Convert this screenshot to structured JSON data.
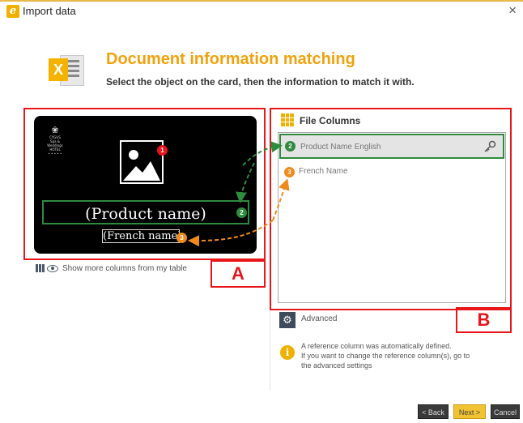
{
  "window": {
    "title": "Import data",
    "close_glyph": "×",
    "app_icon_glyph": "e",
    "app_icon": "app-logo-icon"
  },
  "header": {
    "title": "Document information matching",
    "subtitle": "Select the object on the card, then the information to match it with.",
    "icon": "excel-icon",
    "icon_letter": "X"
  },
  "card": {
    "logo_mark": "❀",
    "logo_lines": [
      "CYGUS",
      "Spa & Weddings",
      "HOTEL",
      "• • • • •"
    ],
    "product_name": "(Product name)",
    "french_name": "(French name)",
    "markers": {
      "image": "1",
      "product": "2",
      "french": "3"
    }
  },
  "left_panel": {
    "show_more_label": "Show more columns from my table",
    "box_label": "A"
  },
  "file_columns": {
    "title": "File Columns",
    "box_label": "B",
    "items": [
      {
        "number": "2",
        "label": "Product Name English",
        "reference": true
      },
      {
        "number": "3",
        "label": "French Name",
        "reference": false
      }
    ]
  },
  "advanced": {
    "label": "Advanced",
    "info_lines": [
      "A reference column was automatically defined.",
      "If you want to change the reference column(s), go to",
      "the advanced settings"
    ]
  },
  "footer": {
    "back_label": "< Back",
    "next_label": "Next >",
    "cancel_label": "Cancel"
  },
  "colors": {
    "accent": "#f0a20c",
    "annotation_red": "#e8151b",
    "link_green": "#2e8b3e",
    "link_orange": "#f08a1c",
    "card_background": "#000000"
  }
}
